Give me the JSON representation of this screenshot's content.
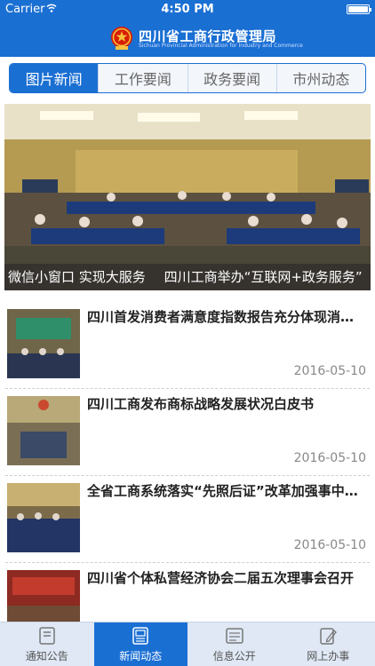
{
  "status_bar": {
    "carrier": "Carrier",
    "time": "4:50 PM",
    "battery_level": 0.9
  },
  "header": {
    "title": "四川省工商行政管理局",
    "subtitle": "Sichuan Provincial Administration for Industry and Commerce"
  },
  "tabs": [
    {
      "label": "图片新闻",
      "active": true
    },
    {
      "label": "工作要闻",
      "active": false
    },
    {
      "label": "政务要闻",
      "active": false
    },
    {
      "label": "市州动态",
      "active": false
    }
  ],
  "hero": {
    "captions": [
      "微信小窗口 实现大服务",
      "四川工商举办“互联网+政务服务”"
    ]
  },
  "news": [
    {
      "title": "四川首发消费者满意度指数报告充分体现消费者诉求",
      "date": "2016-05-10"
    },
    {
      "title": "四川工商发布商标战略发展状况白皮书",
      "date": "2016-05-10"
    },
    {
      "title": "全省工商系统落实“先照后证”改革加强事中事后监管",
      "date": "2016-05-10"
    },
    {
      "title": "四川省个体私营经济协会二届五次理事会召开",
      "date": ""
    }
  ],
  "bottom_nav": [
    {
      "label": "通知公告",
      "icon": "notice-icon",
      "active": false
    },
    {
      "label": "新闻动态",
      "icon": "news-icon",
      "active": true
    },
    {
      "label": "信息公开",
      "icon": "info-icon",
      "active": false
    },
    {
      "label": "网上办事",
      "icon": "edit-icon",
      "active": false
    }
  ],
  "colors": {
    "primary": "#1a6fd3",
    "tab_bg": "#f3f6fb",
    "bottom_nav_bg": "#dfe8f4"
  }
}
